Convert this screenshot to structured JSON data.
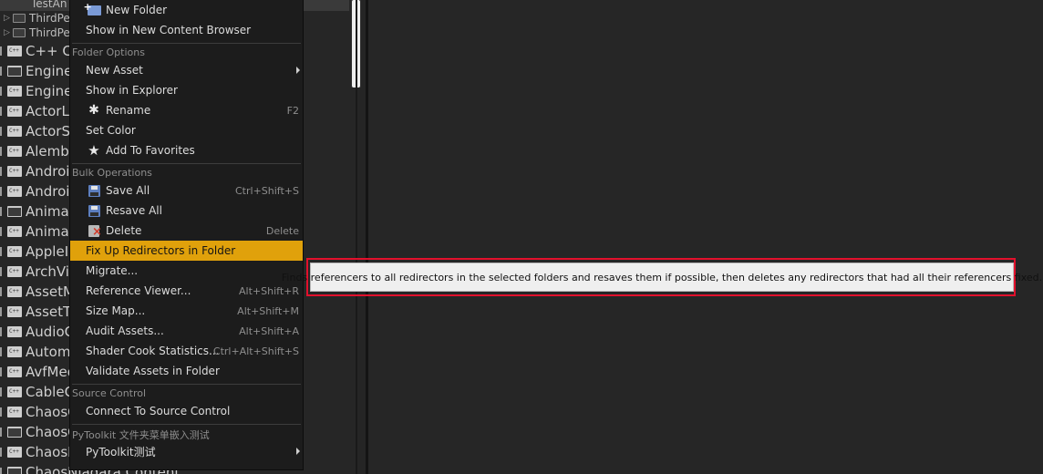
{
  "tree": {
    "top_item": "TestAn",
    "sub_items": [
      "ThirdPe",
      "ThirdPe"
    ],
    "rows": [
      {
        "label": "C++ Cla",
        "icon": "cpp-folder-icon"
      },
      {
        "label": "Engine",
        "icon": "folder-icon"
      },
      {
        "label": "Engine",
        "icon": "cpp-folder-icon"
      },
      {
        "label": "ActorLa",
        "icon": "cpp-folder-icon"
      },
      {
        "label": "ActorSe",
        "icon": "cpp-folder-icon"
      },
      {
        "label": "Alembic",
        "icon": "cpp-folder-icon"
      },
      {
        "label": "Androic",
        "icon": "cpp-folder-icon"
      },
      {
        "label": "Androic",
        "icon": "cpp-folder-icon"
      },
      {
        "label": "Animat",
        "icon": "folder-icon"
      },
      {
        "label": "Animat",
        "icon": "cpp-folder-icon"
      },
      {
        "label": "AppleIr",
        "icon": "cpp-folder-icon"
      },
      {
        "label": "ArchVis",
        "icon": "cpp-folder-icon"
      },
      {
        "label": "AssetM",
        "icon": "cpp-folder-icon"
      },
      {
        "label": "AssetTa",
        "icon": "cpp-folder-icon"
      },
      {
        "label": "AudioC",
        "icon": "cpp-folder-icon"
      },
      {
        "label": "Automa",
        "icon": "cpp-folder-icon"
      },
      {
        "label": "AvfMed",
        "icon": "cpp-folder-icon"
      },
      {
        "label": "CableC",
        "icon": "cpp-folder-icon"
      },
      {
        "label": "ChaosC",
        "icon": "cpp-folder-icon"
      },
      {
        "label": "ChaosC",
        "icon": "folder-icon"
      },
      {
        "label": "ChaosE",
        "icon": "cpp-folder-icon"
      },
      {
        "label": "ChaosNiagara Content",
        "icon": "folder-icon"
      }
    ]
  },
  "menu": {
    "items_top": [
      {
        "label": "New Folder",
        "icon": "new-folder-icon"
      },
      {
        "label": "Show in New Content Browser"
      }
    ],
    "sections": [
      {
        "header": "Folder Options",
        "items": [
          {
            "label": "New Asset",
            "submenu": true
          },
          {
            "label": "Show in Explorer"
          },
          {
            "label": "Rename",
            "icon": "rename-icon",
            "shortcut": "F2"
          },
          {
            "label": "Set Color"
          },
          {
            "label": "Add To Favorites",
            "icon": "star-icon"
          }
        ]
      },
      {
        "header": "Bulk Operations",
        "items": [
          {
            "label": "Save All",
            "icon": "save-icon",
            "shortcut": "Ctrl+Shift+S"
          },
          {
            "label": "Resave All",
            "icon": "save-icon"
          },
          {
            "label": "Delete",
            "icon": "delete-icon",
            "shortcut": "Delete"
          },
          {
            "label": "Fix Up Redirectors in Folder",
            "highlighted": true
          },
          {
            "label": "Migrate..."
          },
          {
            "label": "Reference Viewer...",
            "shortcut": "Alt+Shift+R"
          },
          {
            "label": "Size Map...",
            "shortcut": "Alt+Shift+M"
          },
          {
            "label": "Audit Assets...",
            "shortcut": "Alt+Shift+A"
          },
          {
            "label": "Shader Cook Statistics...",
            "shortcut": "Ctrl+Alt+Shift+S"
          },
          {
            "label": "Validate Assets in Folder"
          }
        ]
      },
      {
        "header": "Source Control",
        "items": [
          {
            "label": "Connect To Source Control"
          }
        ]
      },
      {
        "header": "PyToolkit 文件夹菜单嵌入测试",
        "items": [
          {
            "label": "PyToolkit测试",
            "submenu": true
          }
        ]
      }
    ]
  },
  "tooltip": {
    "text": "Finds referencers to all redirectors in the selected folders and resaves them if possible, then deletes any redirectors that had all their referencers fixed."
  },
  "colors": {
    "highlight": "#e0a10b",
    "annotation_box": "#e2102c",
    "menu_bg": "#1c1c1c",
    "panel_bg": "#262626"
  }
}
